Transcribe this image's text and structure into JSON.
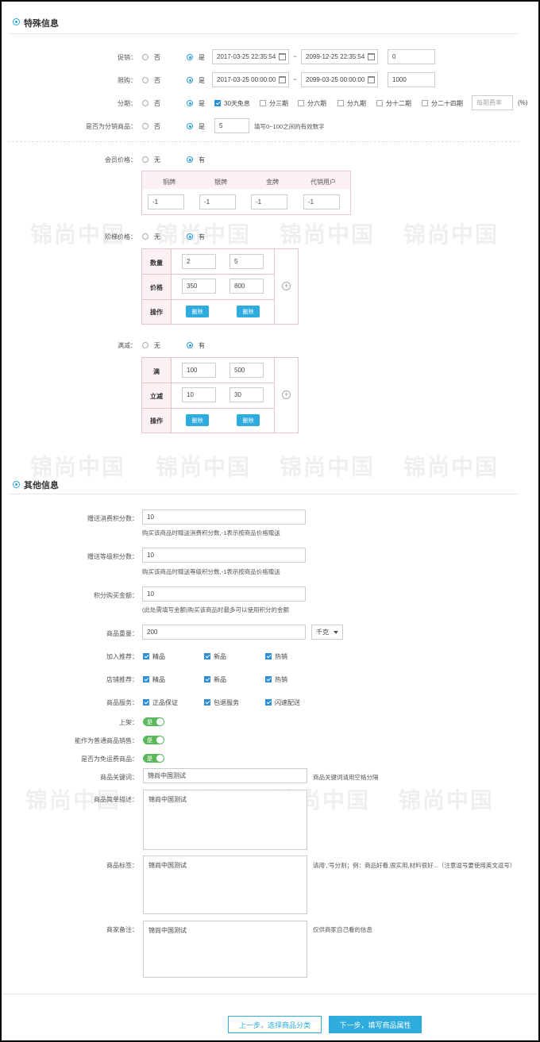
{
  "watermark": "锦尚中国",
  "special": {
    "title": "特殊信息",
    "promo": {
      "label": "促销：",
      "no": "否",
      "yes": "是",
      "start": "2017-03-25 22:35:54",
      "sep": "~",
      "end": "2099-12-25 22:35:54",
      "qty": "0"
    },
    "limit": {
      "label": "限购：",
      "no": "否",
      "yes": "是",
      "start": "2017-03-25 00:00:00",
      "sep": "~",
      "end": "2099-03-25 00:00:00",
      "qty": "1000"
    },
    "install": {
      "label": "分期：",
      "no": "否",
      "yes": "是",
      "options": [
        "30天免息",
        "分三期",
        "分六期",
        "分九期",
        "分十二期",
        "分二十四期"
      ],
      "rate_placeholder": "每期费率",
      "pct": "(%)"
    },
    "dist": {
      "label": "是否为分销商品：",
      "no": "否",
      "yes": "是",
      "value": "5",
      "hint": "填写0~100之间的有效数字"
    },
    "member": {
      "label": "会员价格：",
      "no": "无",
      "yes": "有",
      "headers": [
        "铜牌",
        "银牌",
        "金牌",
        "代销用户"
      ],
      "values": [
        "-1",
        "-1",
        "-1",
        "-1"
      ]
    },
    "ladder": {
      "label": "阶梯价格：",
      "no": "无",
      "yes": "有",
      "row1": "数量",
      "row2": "价格",
      "row3": "操作",
      "qty": [
        "2",
        "5"
      ],
      "price": [
        "350",
        "800"
      ],
      "del": "删除"
    },
    "full": {
      "label": "满减：",
      "no": "无",
      "yes": "有",
      "row1": "满",
      "row2": "立减",
      "row3": "操作",
      "full": [
        "100",
        "500"
      ],
      "minus": [
        "10",
        "30"
      ],
      "del": "删除"
    }
  },
  "other": {
    "title": "其他信息",
    "points": {
      "label": "赠送消费积分数：",
      "value": "10",
      "hint": "购买该商品时赠送消费积分数,-1表示按商品价格赠送"
    },
    "level": {
      "label": "赠送等级积分数：",
      "value": "10",
      "hint": "购买该商品时赠送等级积分数,-1表示按商品价格赠送"
    },
    "buy": {
      "label": "积分购买金额：",
      "value": "10",
      "hint": "(此处需填写金额)购买该商品时最多可以使用积分的金额"
    },
    "weight": {
      "label": "商品重量：",
      "value": "200",
      "unit": "千克"
    },
    "recommend": {
      "label": "加入推荐：",
      "items": [
        "精品",
        "新品",
        "热销"
      ]
    },
    "shop": {
      "label": "店铺推荐：",
      "items": [
        "精品",
        "新品",
        "热销"
      ]
    },
    "service": {
      "label": "商品服务：",
      "items": [
        "正品保证",
        "包退服务",
        "闪速配送"
      ]
    },
    "onsale": {
      "label": "上架：",
      "state": "是"
    },
    "ordinary": {
      "label": "能作为普通商品销售：",
      "state": "是"
    },
    "freeship": {
      "label": "是否为免运费商品：",
      "state": "是"
    },
    "keywords": {
      "label": "商品关键词：",
      "value": "锦尚中国测试",
      "hint": "商品关键词请用空格分隔"
    },
    "brief": {
      "label": "商品简单描述：",
      "value": "锦尚中国测试"
    },
    "tags": {
      "label": "商品标签：",
      "value": "锦尚中国测试",
      "hint": "请用','号分割；例：商品好看,很实用,材料很好...（注意逗号要使用英文逗号）"
    },
    "note": {
      "label": "商家备注：",
      "value": "锦尚中国测试",
      "hint": "仅供商家自己看的信息"
    }
  },
  "buttons": {
    "prev": "上一步，选择商品分类",
    "next": "下一步，填写商品属性"
  }
}
